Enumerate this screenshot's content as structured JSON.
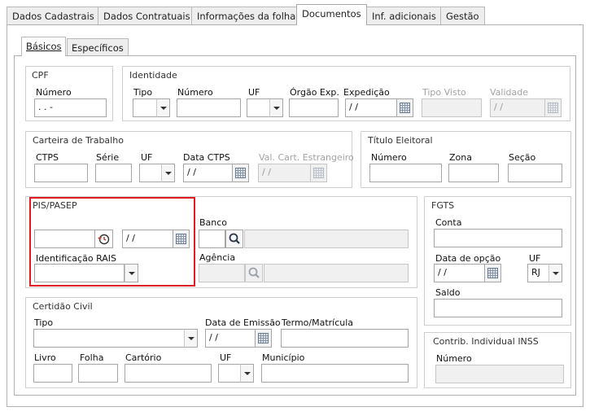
{
  "tabs": {
    "t0": "Dados Cadastrais",
    "t1": "Dados Contratuais",
    "t2": "Informações da folha",
    "t3": "Documentos",
    "t4": "Inf. adicionais",
    "t5": "Gestão"
  },
  "subtabs": {
    "basicos": "Básicos",
    "especificos": "Específicos"
  },
  "cpf": {
    "title": "CPF",
    "numero_label": "Número",
    "numero_value": " .  .  -"
  },
  "identidade": {
    "title": "Identidade",
    "tipo_label": "Tipo",
    "numero_label": "Número",
    "uf_label": "UF",
    "orgao_label": "Órgão Exp.",
    "expedicao_label": "Expedição",
    "expedicao_value": " / /",
    "tipo_visto_label": "Tipo Visto",
    "validade_label": "Validade",
    "validade_value": " / /"
  },
  "ctps": {
    "title": "Carteira de Trabalho",
    "ctps_label": "CTPS",
    "serie_label": "Série",
    "uf_label": "UF",
    "data_label": "Data CTPS",
    "data_value": " / /",
    "val_label": "Val. Cart. Estrangeiro",
    "val_value": " / /"
  },
  "titulo": {
    "title": "Título Eleitoral",
    "numero_label": "Número",
    "zona_label": "Zona",
    "secao_label": "Seção"
  },
  "pis": {
    "title": "PIS/PASEP",
    "date_value": " / /",
    "banco_label": "Banco",
    "rais_label": "Identificação RAIS",
    "agencia_label": "Agência"
  },
  "fgts": {
    "title": "FGTS",
    "conta_label": "Conta",
    "data_opcao_label": "Data de opção",
    "data_opcao_value": " / /",
    "uf_label": "UF",
    "uf_value": "RJ",
    "saldo_label": "Saldo"
  },
  "certidao": {
    "title": "Certidão Civil",
    "tipo_label": "Tipo",
    "data_emissao_label": "Data de Emissão",
    "data_emissao_value": " / /",
    "termo_label": "Termo/Matrícula",
    "livro_label": "Livro",
    "folha_label": "Folha",
    "cartorio_label": "Cartório",
    "uf_label": "UF",
    "municipio_label": "Município"
  },
  "inss": {
    "title": "Contrib. Individual INSS",
    "numero_label": "Número"
  },
  "highlight_color": "#e01b24"
}
